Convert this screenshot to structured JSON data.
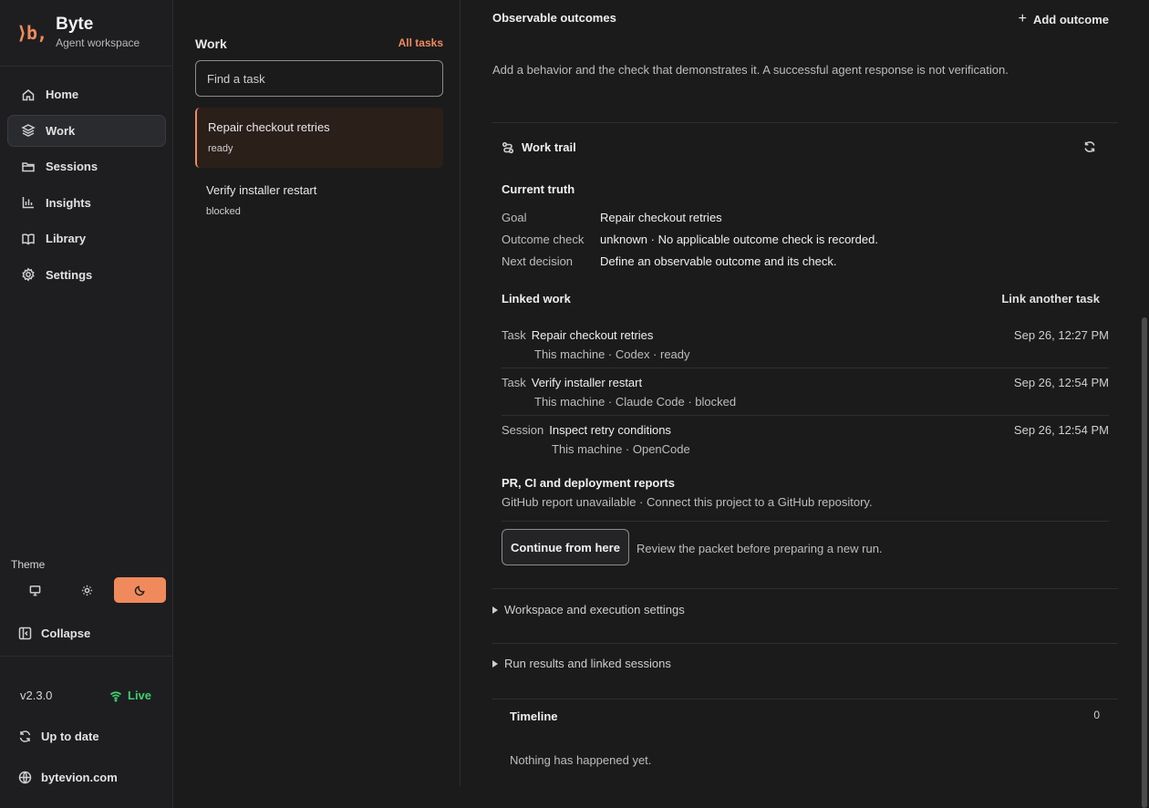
{
  "brand": {
    "logo": "⟩b,",
    "name": "Byte",
    "subtitle": "Agent workspace"
  },
  "nav": [
    {
      "label": "Home",
      "icon": "home-icon"
    },
    {
      "label": "Work",
      "icon": "layers-icon",
      "active": true
    },
    {
      "label": "Sessions",
      "icon": "folder-icon"
    },
    {
      "label": "Insights",
      "icon": "bar-chart-icon"
    },
    {
      "label": "Library",
      "icon": "book-icon"
    },
    {
      "label": "Settings",
      "icon": "gear-icon"
    }
  ],
  "theme": {
    "label": "Theme",
    "options": [
      "system",
      "light",
      "dark"
    ],
    "selected": "dark"
  },
  "sidebar_footer": {
    "collapse": "Collapse",
    "version": "v2.3.0",
    "live": "Live",
    "update": "Up to date",
    "website": "bytevion.com"
  },
  "work": {
    "title": "Work",
    "all_tasks": "All tasks",
    "search_placeholder": "Find a task",
    "tasks": [
      {
        "title": "Repair checkout retries",
        "status": "ready",
        "selected": true
      },
      {
        "title": "Verify installer restart",
        "status": "blocked"
      }
    ]
  },
  "main": {
    "outcomes_title": "Observable outcomes",
    "add_outcome": "Add outcome",
    "outcomes_desc": "Add a behavior and the check that demonstrates it. A successful agent response is not verification.",
    "work_trail": "Work trail",
    "current_truth": "Current truth",
    "truth": [
      {
        "label": "Goal",
        "value": "Repair checkout retries"
      },
      {
        "label": "Outcome check",
        "value": "unknown · No applicable outcome check is recorded."
      },
      {
        "label": "Next decision",
        "value": "Define an observable outcome and its check."
      }
    ],
    "linked_work": "Linked work",
    "link_another": "Link another task",
    "linked": [
      {
        "kind": "Task",
        "name": "Repair checkout retries",
        "meta": "This machine · Codex · ready",
        "date": "Sep 26, 12:27 PM"
      },
      {
        "kind": "Task",
        "name": "Verify installer restart",
        "meta": "This machine · Claude Code · blocked",
        "date": "Sep 26, 12:54 PM"
      },
      {
        "kind": "Session",
        "name": "Inspect retry conditions",
        "meta": "This machine · OpenCode",
        "date": "Sep 26, 12:54 PM"
      }
    ],
    "reports_title": "PR, CI and deployment reports",
    "reports_desc": "GitHub report unavailable · Connect this project to a GitHub repository.",
    "continue_btn": "Continue from here",
    "continue_desc": "Review the packet before preparing a new run.",
    "workspace_settings": "Workspace and execution settings",
    "run_results": "Run results and linked sessions",
    "timeline": "Timeline",
    "timeline_count": "0",
    "timeline_empty": "Nothing has happened yet."
  }
}
